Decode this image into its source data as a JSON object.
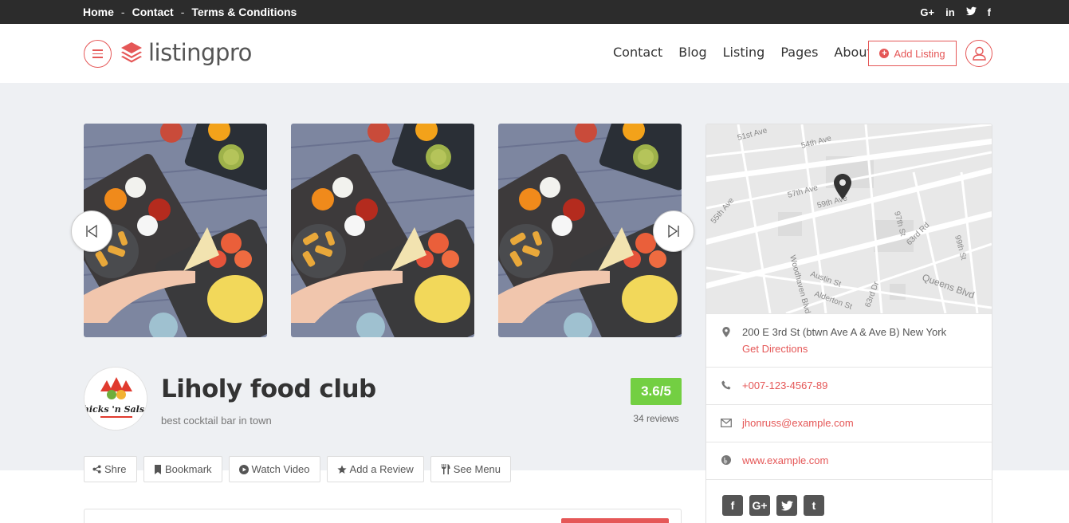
{
  "topbar": {
    "links": [
      "Home",
      "Contact",
      "Terms & Conditions"
    ],
    "separator": "-",
    "social": [
      "G+",
      "in",
      "t",
      "f"
    ]
  },
  "header": {
    "logo_text": "listingpro",
    "nav": [
      "Contact",
      "Blog",
      "Listing",
      "Pages",
      "About"
    ],
    "add_listing_label": "Add Listing"
  },
  "listing": {
    "brand_logo_text": "hicks 'n Salsa",
    "title": "Liholy food club",
    "tagline": "best cocktail bar in town",
    "rating": "3.6/5",
    "reviews": "34 reviews"
  },
  "actions": [
    "Shre",
    "Bookmark",
    "Watch Video",
    "Add a Review",
    "See Menu"
  ],
  "sidebar": {
    "map_labels": [
      "51st Ave",
      "54th Ave",
      "57th Ave",
      "59th Ave",
      "55th Ave",
      "97th St",
      "63rd Rd",
      "99th St",
      "Queens Blvd",
      "Austin St",
      "Alderton St",
      "Woodhaven Blvd",
      "63rd Dr"
    ],
    "address": "200 E 3rd St (btwn Ave A & Ave B) New York",
    "directions": "Get Directions",
    "phone": "+007-123-4567-89",
    "email": "jhonruss@example.com",
    "website": "www.example.com",
    "social": [
      "f",
      "G+",
      "t",
      "t"
    ]
  },
  "colors": {
    "accent": "#e55757",
    "rating": "#73cf42",
    "topbar": "#2c2c2c",
    "hero_bg": "#eef0f3"
  }
}
